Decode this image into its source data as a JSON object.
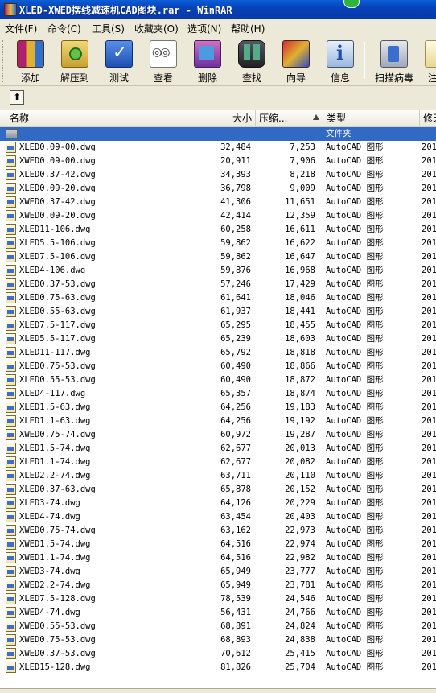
{
  "window": {
    "title": "XLED-XWED摆线减速机CAD图块.rar - WinRAR"
  },
  "menu": [
    "文件(F)",
    "命令(C)",
    "工具(S)",
    "收藏夹(O)",
    "选项(N)",
    "帮助(H)"
  ],
  "toolbar": {
    "add": "添加",
    "extract": "解压到",
    "test": "测试",
    "view": "查看",
    "delete": "删除",
    "find": "查找",
    "wizard": "向导",
    "info": "信息",
    "scan": "扫描病毒",
    "comment": "注"
  },
  "columns": {
    "name": "名称",
    "size": "大小",
    "packed": "压缩...",
    "type": "类型",
    "modified": "修改"
  },
  "folder_row": {
    "type": "文件夹"
  },
  "files": [
    {
      "name": "XLED0.09-00.dwg",
      "size": "32,484",
      "packed": "7,253",
      "type": "AutoCAD 图形",
      "mod": "201"
    },
    {
      "name": "XWED0.09-00.dwg",
      "size": "20,911",
      "packed": "7,906",
      "type": "AutoCAD 图形",
      "mod": "201"
    },
    {
      "name": "XLED0.37-42.dwg",
      "size": "34,393",
      "packed": "8,218",
      "type": "AutoCAD 图形",
      "mod": "201"
    },
    {
      "name": "XLED0.09-20.dwg",
      "size": "36,798",
      "packed": "9,009",
      "type": "AutoCAD 图形",
      "mod": "201"
    },
    {
      "name": "XWED0.37-42.dwg",
      "size": "41,306",
      "packed": "11,651",
      "type": "AutoCAD 图形",
      "mod": "201"
    },
    {
      "name": "XWED0.09-20.dwg",
      "size": "42,414",
      "packed": "12,359",
      "type": "AutoCAD 图形",
      "mod": "201"
    },
    {
      "name": "XLED11-106.dwg",
      "size": "60,258",
      "packed": "16,611",
      "type": "AutoCAD 图形",
      "mod": "201"
    },
    {
      "name": "XLED5.5-106.dwg",
      "size": "59,862",
      "packed": "16,622",
      "type": "AutoCAD 图形",
      "mod": "201"
    },
    {
      "name": "XLED7.5-106.dwg",
      "size": "59,862",
      "packed": "16,647",
      "type": "AutoCAD 图形",
      "mod": "201"
    },
    {
      "name": "XLED4-106.dwg",
      "size": "59,876",
      "packed": "16,968",
      "type": "AutoCAD 图形",
      "mod": "201"
    },
    {
      "name": "XLED0.37-53.dwg",
      "size": "57,246",
      "packed": "17,429",
      "type": "AutoCAD 图形",
      "mod": "201"
    },
    {
      "name": "XLED0.75-63.dwg",
      "size": "61,641",
      "packed": "18,046",
      "type": "AutoCAD 图形",
      "mod": "201"
    },
    {
      "name": "XLED0.55-63.dwg",
      "size": "61,937",
      "packed": "18,441",
      "type": "AutoCAD 图形",
      "mod": "201"
    },
    {
      "name": "XLED7.5-117.dwg",
      "size": "65,295",
      "packed": "18,455",
      "type": "AutoCAD 图形",
      "mod": "201"
    },
    {
      "name": "XLED5.5-117.dwg",
      "size": "65,239",
      "packed": "18,603",
      "type": "AutoCAD 图形",
      "mod": "201"
    },
    {
      "name": "XLED11-117.dwg",
      "size": "65,792",
      "packed": "18,818",
      "type": "AutoCAD 图形",
      "mod": "201"
    },
    {
      "name": "XLED0.75-53.dwg",
      "size": "60,490",
      "packed": "18,866",
      "type": "AutoCAD 图形",
      "mod": "201"
    },
    {
      "name": "XLED0.55-53.dwg",
      "size": "60,490",
      "packed": "18,872",
      "type": "AutoCAD 图形",
      "mod": "201"
    },
    {
      "name": "XLED4-117.dwg",
      "size": "65,357",
      "packed": "18,874",
      "type": "AutoCAD 图形",
      "mod": "201"
    },
    {
      "name": "XLED1.5-63.dwg",
      "size": "64,256",
      "packed": "19,183",
      "type": "AutoCAD 图形",
      "mod": "201"
    },
    {
      "name": "XLED1.1-63.dwg",
      "size": "64,256",
      "packed": "19,192",
      "type": "AutoCAD 图形",
      "mod": "201"
    },
    {
      "name": "XWED0.75-74.dwg",
      "size": "60,972",
      "packed": "19,287",
      "type": "AutoCAD 图形",
      "mod": "201"
    },
    {
      "name": "XLED1.5-74.dwg",
      "size": "62,677",
      "packed": "20,013",
      "type": "AutoCAD 图形",
      "mod": "201"
    },
    {
      "name": "XLED1.1-74.dwg",
      "size": "62,677",
      "packed": "20,082",
      "type": "AutoCAD 图形",
      "mod": "201"
    },
    {
      "name": "XLED2.2-74.dwg",
      "size": "63,711",
      "packed": "20,110",
      "type": "AutoCAD 图形",
      "mod": "201"
    },
    {
      "name": "XLED0.37-63.dwg",
      "size": "65,878",
      "packed": "20,152",
      "type": "AutoCAD 图形",
      "mod": "201"
    },
    {
      "name": "XLED3-74.dwg",
      "size": "64,126",
      "packed": "20,229",
      "type": "AutoCAD 图形",
      "mod": "201"
    },
    {
      "name": "XLED4-74.dwg",
      "size": "63,454",
      "packed": "20,403",
      "type": "AutoCAD 图形",
      "mod": "201"
    },
    {
      "name": "XWED0.75-74.dwg",
      "size": "63,162",
      "packed": "22,973",
      "type": "AutoCAD 图形",
      "mod": "201"
    },
    {
      "name": "XWED1.5-74.dwg",
      "size": "64,516",
      "packed": "22,974",
      "type": "AutoCAD 图形",
      "mod": "201"
    },
    {
      "name": "XWED1.1-74.dwg",
      "size": "64,516",
      "packed": "22,982",
      "type": "AutoCAD 图形",
      "mod": "201"
    },
    {
      "name": "XWED3-74.dwg",
      "size": "65,949",
      "packed": "23,777",
      "type": "AutoCAD 图形",
      "mod": "201"
    },
    {
      "name": "XWED2.2-74.dwg",
      "size": "65,949",
      "packed": "23,781",
      "type": "AutoCAD 图形",
      "mod": "201"
    },
    {
      "name": "XLED7.5-128.dwg",
      "size": "78,539",
      "packed": "24,546",
      "type": "AutoCAD 图形",
      "mod": "201"
    },
    {
      "name": "XWED4-74.dwg",
      "size": "56,431",
      "packed": "24,766",
      "type": "AutoCAD 图形",
      "mod": "201"
    },
    {
      "name": "XWED0.55-53.dwg",
      "size": "68,891",
      "packed": "24,824",
      "type": "AutoCAD 图形",
      "mod": "201"
    },
    {
      "name": "XWED0.75-53.dwg",
      "size": "68,893",
      "packed": "24,838",
      "type": "AutoCAD 图形",
      "mod": "201"
    },
    {
      "name": "XWED0.37-53.dwg",
      "size": "70,612",
      "packed": "25,415",
      "type": "AutoCAD 图形",
      "mod": "201"
    },
    {
      "name": "XLED15-128.dwg",
      "size": "81,826",
      "packed": "25,704",
      "type": "AutoCAD 图形",
      "mod": "201"
    }
  ]
}
